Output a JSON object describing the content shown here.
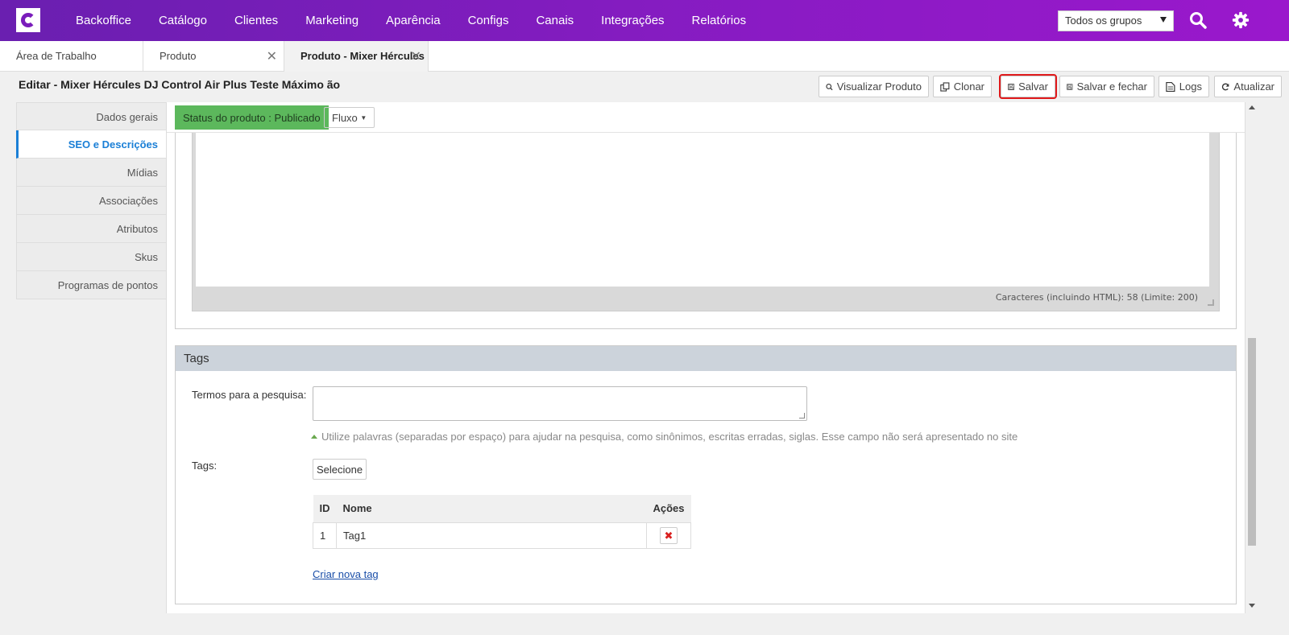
{
  "nav": {
    "items": [
      "Backoffice",
      "Catálogo",
      "Clientes",
      "Marketing",
      "Aparência",
      "Configs",
      "Canais",
      "Integrações",
      "Relatórios"
    ],
    "group_select": "Todos os grupos",
    "colors": {
      "start": "#6a1fb0",
      "end": "#9a18cc"
    }
  },
  "tabs": [
    {
      "label": "Área de Trabalho"
    },
    {
      "label": "Produto"
    },
    {
      "label": "Produto - Mixer Hércules"
    }
  ],
  "page": {
    "title": "Editar - Mixer Hércules DJ Control Air Plus Teste Máximo ão"
  },
  "toolbar": {
    "view": "Visualizar Produto",
    "clone": "Clonar",
    "save": "Salvar",
    "save_close": "Salvar e fechar",
    "logs": "Logs",
    "refresh": "Atualizar"
  },
  "sidebar": {
    "items": [
      {
        "label": "Dados gerais"
      },
      {
        "label": "SEO e Descrições"
      },
      {
        "label": "Mídias"
      },
      {
        "label": "Associações"
      },
      {
        "label": "Atributos"
      },
      {
        "label": "Skus"
      },
      {
        "label": "Programas de pontos"
      }
    ],
    "active": "SEO e Descrições"
  },
  "status": {
    "badge": "Status do produto : Publicado",
    "flow": "Fluxo",
    "badge_color": "#5cb85c"
  },
  "editor": {
    "char_count": "Caracteres (incluindo HTML): 58 (Limite: 200)"
  },
  "tags_section": {
    "title": "Tags",
    "search_terms_label": "Termos para a pesquisa:",
    "search_terms_value": "",
    "hint": "Utilize palavras (separadas por espaço) para ajudar na pesquisa, como sinônimos, escritas erradas, siglas. Esse campo não será apresentado no site",
    "tags_label": "Tags:",
    "select_button": "Selecione",
    "table": {
      "headers": [
        "ID",
        "Nome",
        "Ações"
      ],
      "rows": [
        {
          "id": "1",
          "name": "Tag1"
        }
      ]
    },
    "new_tag_link": "Criar nova tag"
  }
}
